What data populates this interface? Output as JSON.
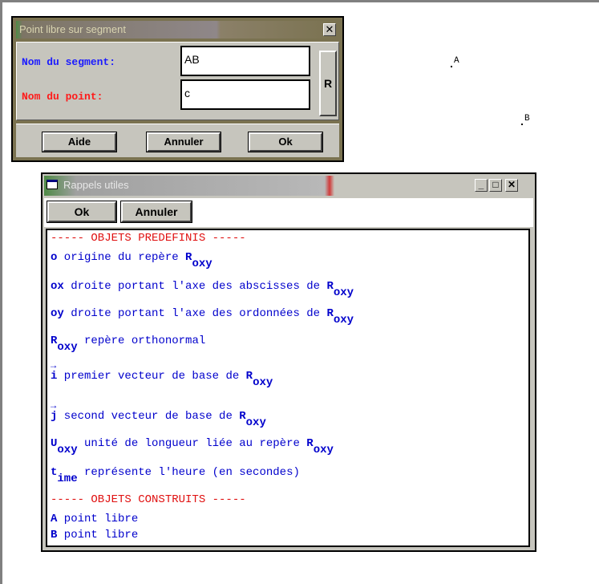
{
  "canvas": {
    "points": [
      {
        "label": "A"
      },
      {
        "label": "B"
      }
    ]
  },
  "dialog_segment": {
    "title": "Point libre sur segment",
    "close_glyph": "✕",
    "segment_label": "Nom du segment:",
    "segment_value": "AB",
    "point_label": "Nom du point:",
    "point_value": "c",
    "r_button": "R",
    "help_button": "Aide",
    "cancel_button": "Annuler",
    "ok_button": "Ok",
    "colors": {
      "segment_label": "#1a1aff",
      "point_label": "#ff1a1a"
    }
  },
  "dialog_reminders": {
    "title": "Rappels utiles",
    "minimize_glyph": "_",
    "maximize_glyph": "□",
    "close_glyph": "✕",
    "ok_button": "Ok",
    "cancel_button": "Annuler",
    "header_predefined": "----- OBJETS PREDEFINIS -----",
    "header_constructed": "----- OBJETS CONSTRUITS -----",
    "items": [
      {
        "sym": "o",
        "text": " origine du repère ",
        "ref": "R",
        "ref_sub": "oxy"
      },
      {
        "sym": "ox",
        "text": " droite portant l'axe des abscisses de ",
        "ref": "R",
        "ref_sub": "oxy"
      },
      {
        "sym": "oy",
        "text": " droite portant l'axe des ordonnées de ",
        "ref": "R",
        "ref_sub": "oxy"
      },
      {
        "sym": "R",
        "sym_sub": "oxy",
        "text": " repère orthonormal"
      },
      {
        "sym": "i",
        "vector": "→",
        "text": " premier vecteur de base de ",
        "ref": "R",
        "ref_sub": "oxy"
      },
      {
        "sym": "j",
        "vector": "→",
        "text": " second vecteur de base de ",
        "ref": "R",
        "ref_sub": "oxy"
      },
      {
        "sym": "U",
        "sym_sub": "oxy",
        "text": " unité de longueur liée au repère ",
        "ref": "R",
        "ref_sub": "oxy"
      },
      {
        "sym": "t",
        "sym_sub": "ime",
        "text": " représente l'heure (en secondes)"
      }
    ],
    "constructed": [
      {
        "sym": "A",
        "text": " point libre"
      },
      {
        "sym": "B",
        "text": " point libre"
      }
    ]
  }
}
